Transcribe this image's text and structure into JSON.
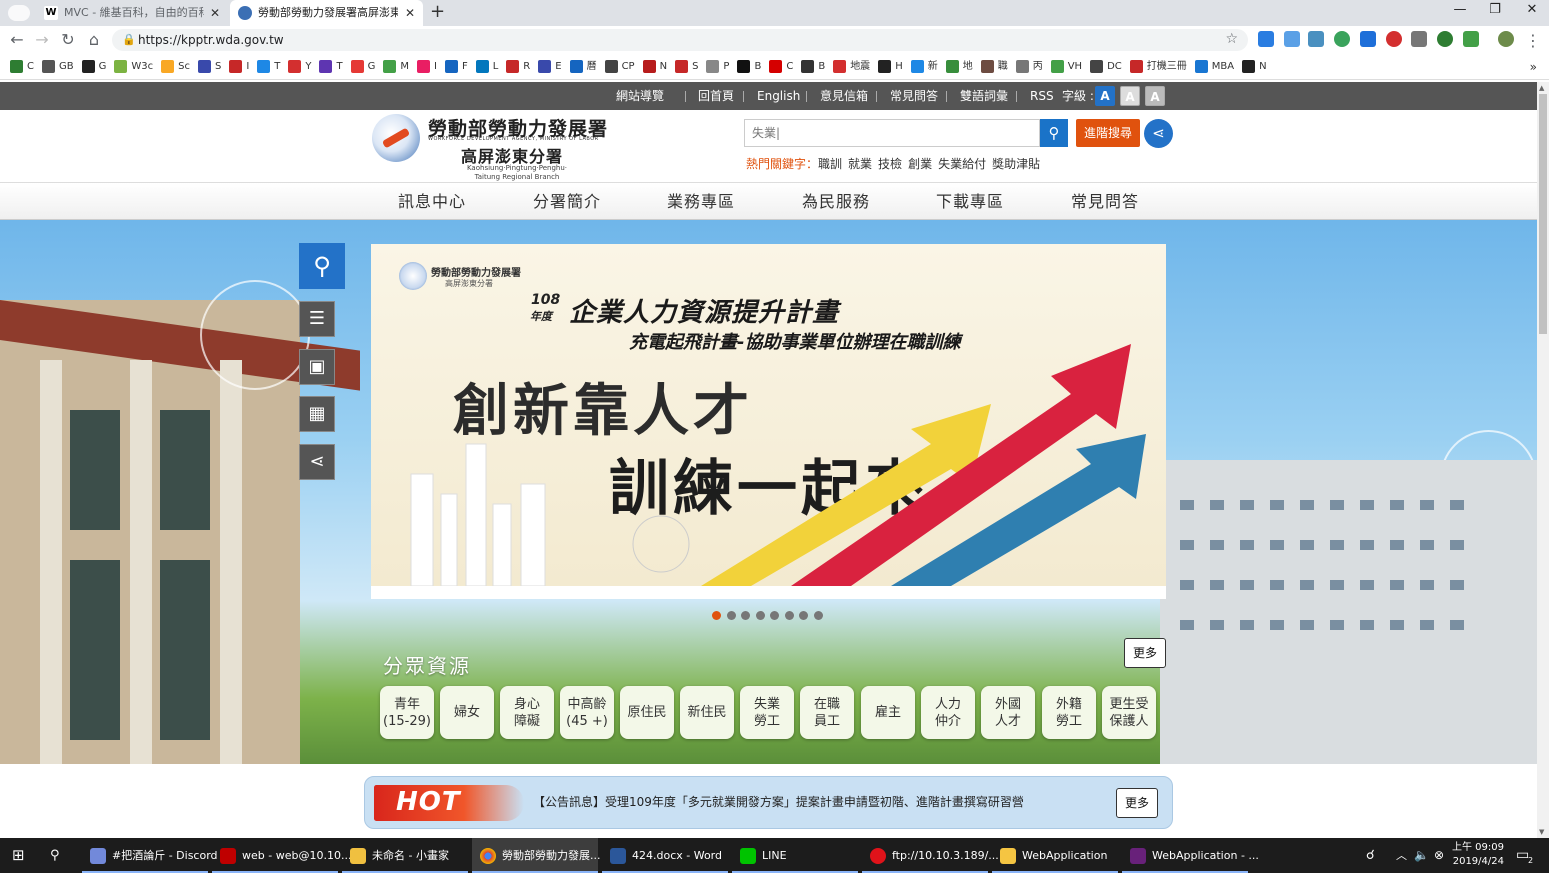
{
  "browser": {
    "tabs": [
      {
        "label": "MVC - 維基百科，自由的百科全書",
        "icon": "wikipedia-icon"
      },
      {
        "label": "勞動部勞動力發展署高屏澎東分署",
        "icon": "site-favicon"
      }
    ],
    "url": "https://kpptr.wda.gov.tw",
    "bookmarks": [
      "C",
      "GB",
      "G",
      "W3c",
      "Sc",
      "S",
      "I",
      "T",
      "Y",
      "T",
      "G",
      "M",
      "I",
      "F",
      "L",
      "R",
      "E",
      "曆",
      "CP",
      "N",
      "S",
      "P",
      "B",
      "C",
      "B",
      "地震",
      "H",
      "新",
      "地",
      "職",
      "丙",
      "VH",
      "DC",
      "打機三冊",
      "MBA",
      "N"
    ],
    "more": "»"
  },
  "util": {
    "sitemap": "網站導覽",
    "home": "回首頁",
    "english": "English",
    "mailbox": "意見信箱",
    "faq": "常見問答",
    "glossary": "雙語詞彙",
    "rss": "RSS",
    "fontsize": "字級 :",
    "fs_labels": [
      "A",
      "A",
      "A"
    ]
  },
  "header": {
    "org_title": "勞動部勞動力發展署",
    "org_en": "WORKFORCE DEVELOPMENT AGENCY, MINISTRY OF LABOR",
    "branch": "高屏澎東分署",
    "branch_en": "Kaohsiung‧Pingtung‧Penghu‧Taitung Regional Branch",
    "search_value": "失業|",
    "advanced_search": "進階搜尋",
    "hot_label": "熱門關鍵字：",
    "hot_keywords": [
      "職訓",
      "就業",
      "技檢",
      "創業",
      "失業給付",
      "獎助津貼"
    ]
  },
  "nav": [
    "訊息中心",
    "分署簡介",
    "業務專區",
    "為民服務",
    "下載專區",
    "常見問答"
  ],
  "banner": {
    "org": "勞動部勞動力發展署",
    "branch": "高屏澎東分署",
    "year": "108",
    "year_suffix": "年度",
    "title": "企業人力資源提升計畫",
    "subtitle": "充電起飛計畫-協助事業單位辦理在職訓練",
    "slogan1": "創新靠人才",
    "slogan2": "訓練一起來",
    "slide_count": 8,
    "active_slide": 1
  },
  "audience": {
    "title": "分眾資源",
    "more": "更多",
    "items": [
      "青年\n(15-29)",
      "婦女",
      "身心\n障礙",
      "中高齡\n(45 +)",
      "原住民",
      "新住民",
      "失業\n勞工",
      "在職\n員工",
      "雇主",
      "人力\n仲介",
      "外國\n人才",
      "外籍\n勞工",
      "更生受\n保護人"
    ]
  },
  "news": {
    "badge": "HOT",
    "text": "【公告訊息】受理109年度「多元就業開發方案」提案計畫申請暨初階、進階計畫撰寫研習營",
    "more": "更多"
  },
  "taskbar": {
    "items": [
      "#把酒論斤 - Discord",
      "web - web@10.10...",
      "未命名 - 小畫家",
      "勞動部勞動力發展...",
      "424.docx - Word",
      "LINE",
      "ftp://10.10.3.189/...",
      "WebApplication",
      "WebApplication - ..."
    ],
    "time": "上午 09:09",
    "date": "2019/4/24",
    "notifications": "2"
  },
  "colors": {
    "accent_blue": "#2372c8",
    "accent_orange": "#e0520e",
    "util_bar": "#555555"
  }
}
